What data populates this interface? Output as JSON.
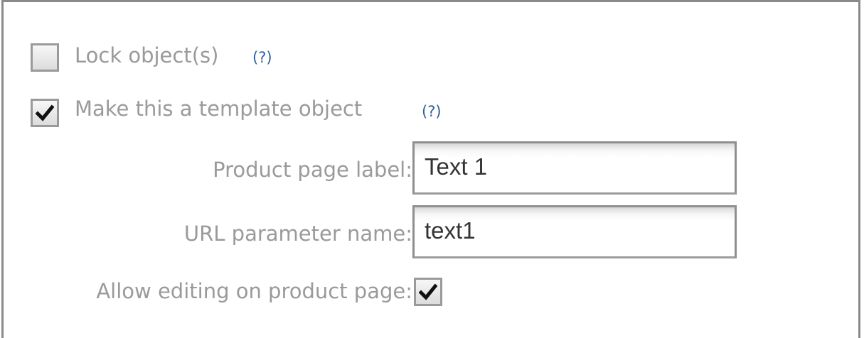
{
  "options": {
    "lock": {
      "label": "Lock object(s)",
      "help": "(?)",
      "checked": false
    },
    "template": {
      "label": "Make this a template object",
      "help": "(?)",
      "checked": true
    }
  },
  "template_settings": {
    "product_page_label": {
      "label": "Product page label:",
      "value": "Text 1"
    },
    "url_parameter_name": {
      "label": "URL parameter name:",
      "value": "text1"
    },
    "allow_editing": {
      "label": "Allow editing on product page:",
      "checked": true
    }
  },
  "colors": {
    "border": "#8a8a8a",
    "label_text": "#9a9a9a",
    "help_link": "#2f5fa0",
    "input_text": "#333333"
  }
}
